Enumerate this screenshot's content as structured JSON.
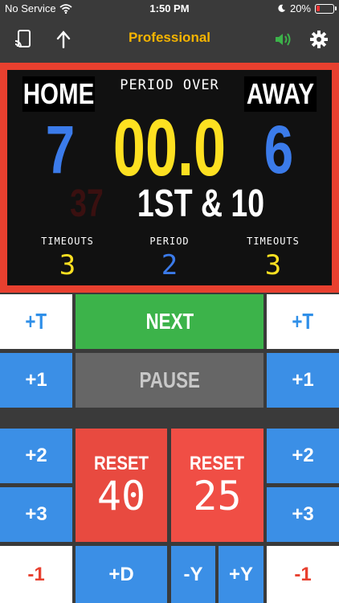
{
  "status": {
    "carrier": "No Service",
    "time": "1:50 PM",
    "battery": "20%",
    "battery_level": 0.2
  },
  "toolbar": {
    "title": "Professional",
    "icons": [
      "cast-icon",
      "share-icon",
      "speaker-icon",
      "gear-icon"
    ]
  },
  "board": {
    "home_label": "HOME",
    "away_label": "AWAY",
    "status_text": "PERIOD OVER",
    "home_score": "7",
    "away_score": "6",
    "clock": "00.0",
    "play_clock": "37",
    "down_distance": "1ST & 10",
    "timeouts_label": "TIMEOUTS",
    "period_label": "PERIOD",
    "home_timeouts": "3",
    "period": "2",
    "away_timeouts": "3"
  },
  "controls": {
    "add_timeout": "+T",
    "next": "NEXT",
    "add1": "+1",
    "pause": "PAUSE",
    "add2": "+2",
    "add3": "+3",
    "reset": "RESET",
    "reset_40": "40",
    "reset_25": "25",
    "minus1": "-1",
    "add_down": "+D",
    "minus_yard": "-Y",
    "plus_yard": "+Y"
  },
  "colors": {
    "home": "#3b7bea",
    "away": "#3b7bea",
    "clock": "#fde021",
    "frame": "#e8402f",
    "title": "#f5b400"
  }
}
